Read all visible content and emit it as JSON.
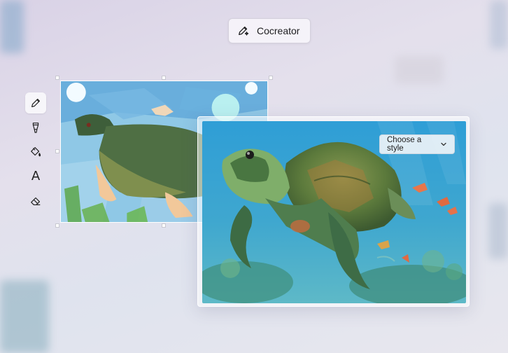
{
  "header": {
    "app_label": "Cocreator"
  },
  "toolbar": {
    "tools": [
      {
        "name": "pen",
        "active": true
      },
      {
        "name": "brush",
        "active": false
      },
      {
        "name": "fill",
        "active": false
      },
      {
        "name": "text",
        "active": false,
        "glyph": "A"
      },
      {
        "name": "eraser",
        "active": false
      }
    ]
  },
  "result_panel": {
    "style_select": {
      "label": "Choose a style"
    }
  },
  "colors": {
    "accent": "#1d1d1f",
    "sketch_water": "#8ec8e6",
    "turtle_dark": "#3e5e3a",
    "turtle_olive": "#7f8f4e"
  }
}
